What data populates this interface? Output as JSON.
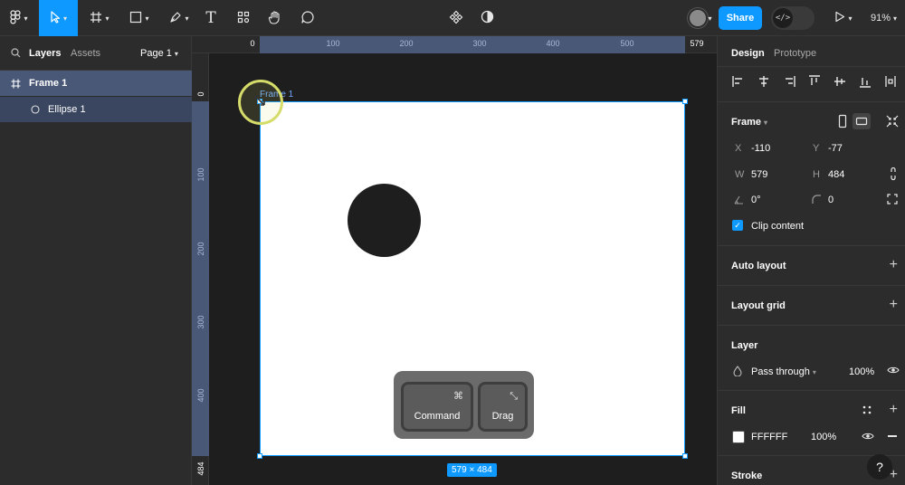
{
  "toolbar": {
    "zoom": "91%",
    "share_label": "Share"
  },
  "left_panel": {
    "tabs": [
      "Layers",
      "Assets"
    ],
    "page_selector": "Page 1",
    "layers": [
      {
        "name": "Frame 1"
      },
      {
        "name": "Ellipse 1"
      }
    ]
  },
  "canvas": {
    "frame_label": "Frame 1",
    "size_badge": "579 × 484",
    "ruler_top": [
      "0",
      "100",
      "200",
      "300",
      "400",
      "500",
      "579"
    ],
    "ruler_left": [
      "0",
      "100",
      "200",
      "300",
      "400",
      "484"
    ],
    "keys": [
      {
        "symbol": "⌘",
        "label": "Command"
      },
      {
        "symbol": "⤡",
        "label": "Drag"
      }
    ]
  },
  "right_panel": {
    "tabs": [
      "Design",
      "Prototype"
    ],
    "frame": {
      "title": "Frame",
      "x_label": "X",
      "x_value": "-110",
      "y_label": "Y",
      "y_value": "-77",
      "w_label": "W",
      "w_value": "579",
      "h_label": "H",
      "h_value": "484",
      "rotation": "0°",
      "radius": "0",
      "clip_content": "Clip content"
    },
    "auto_layout": "Auto layout",
    "layout_grid": "Layout grid",
    "layer": {
      "title": "Layer",
      "blend": "Pass through",
      "opacity": "100%"
    },
    "fill": {
      "title": "Fill",
      "hex": "FFFFFF",
      "opacity": "100%"
    },
    "stroke": "Stroke"
  },
  "colors": {
    "accent": "#0d99ff",
    "panel": "#2c2c2c",
    "canvas": "#1e1e1e",
    "selection": "#4a5878"
  }
}
